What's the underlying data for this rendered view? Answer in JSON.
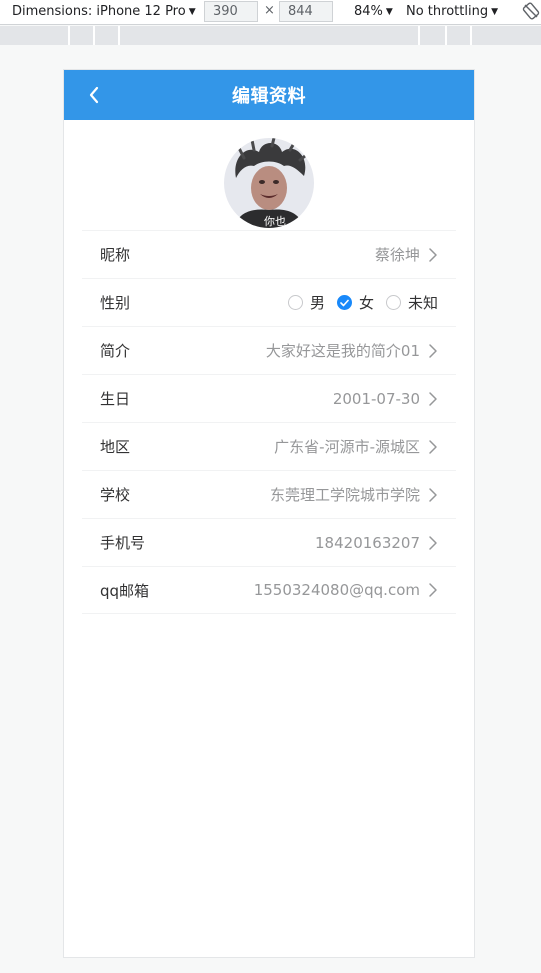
{
  "devtools": {
    "device_label": "Dimensions: iPhone 12 Pro",
    "width": "390",
    "height": "844",
    "times": "×",
    "zoom": "84%",
    "throttling": "No throttling"
  },
  "nav": {
    "title": "编辑资料"
  },
  "avatar": {
    "caption": "你也"
  },
  "fields": {
    "nickname": {
      "label": "昵称",
      "value": "蔡徐坤"
    },
    "gender": {
      "label": "性别",
      "options": [
        "男",
        "女",
        "未知"
      ],
      "selected": "女"
    },
    "intro": {
      "label": "简介",
      "value": "大家好这是我的简介01"
    },
    "birthday": {
      "label": "生日",
      "value": "2001-07-30"
    },
    "region": {
      "label": "地区",
      "value": "广东省-河源市-源城区"
    },
    "school": {
      "label": "学校",
      "value": "东莞理工学院城市学院"
    },
    "phone": {
      "label": "手机号",
      "value": "18420163207"
    },
    "email": {
      "label": "qq邮箱",
      "value": "1550324080@qq.com"
    }
  },
  "colors": {
    "nav_bg": "#3396e8",
    "radio_checked": "#1989fa"
  }
}
